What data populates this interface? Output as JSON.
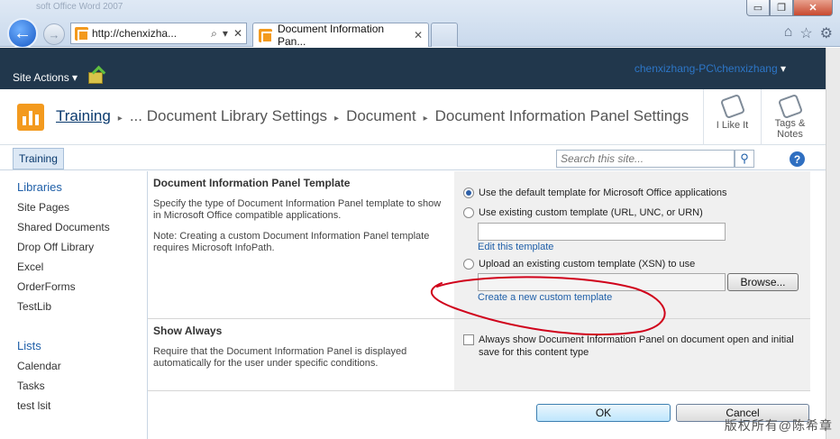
{
  "browser": {
    "ghost_title": "soft Office Word 2007",
    "address_url": "http://chenxizha...",
    "search_glyph": "⌕",
    "dropdown_glyph": "▾",
    "close_glyph": "✕",
    "tab_title": "Document Information Pan...",
    "tab_close": "✕",
    "minimize": "▭",
    "restore": "❐",
    "close": "✕",
    "icons": [
      "⌂",
      "☆",
      "⚙"
    ]
  },
  "ribbon": {
    "site_actions": "Site Actions",
    "site_actions_arrow": "▾",
    "user": "chenxizhang-PC\\chenxizhang",
    "user_arrow": "▾"
  },
  "title": {
    "site": "Training",
    "crumb1": "... Document Library Settings",
    "crumb2": "Document",
    "crumb3": "Document Information Panel Settings",
    "sep": "▸",
    "like": "I Like It",
    "tags_line1": "Tags &",
    "tags_line2": "Notes"
  },
  "topnav": {
    "tab": "Training",
    "search_placeholder": "Search this site...",
    "help": "?"
  },
  "quicklaunch": {
    "libraries_heading": "Libraries",
    "libraries": [
      "Site Pages",
      "Shared Documents",
      "Drop Off Library",
      "Excel",
      "OrderForms",
      "TestLib"
    ],
    "lists_heading": "Lists",
    "lists": [
      "Calendar",
      "Tasks",
      "test lsit"
    ]
  },
  "section1": {
    "title": "Document Information Panel Template",
    "desc": "Specify the type of Document Information Panel template to show in Microsoft Office compatible applications.",
    "note": "Note: Creating a custom Document Information Panel template requires Microsoft InfoPath.",
    "option_default": "Use the default template for Microsoft Office applications",
    "option_existing": "Use existing custom template (URL, UNC, or URN)",
    "edit_link": "Edit this template",
    "option_upload": "Upload an existing custom template (XSN) to use",
    "browse": "Browse...",
    "create_link": "Create a new custom template"
  },
  "section2": {
    "title": "Show Always",
    "desc": "Require that the Document Information Panel is displayed automatically for the user under specific conditions.",
    "checkbox_label": "Always show Document Information Panel on document open and initial save for this content type"
  },
  "buttons": {
    "ok": "OK",
    "cancel": "Cancel"
  },
  "watermark": "版权所有@陈希章",
  "annotation_color": "#d0021b"
}
